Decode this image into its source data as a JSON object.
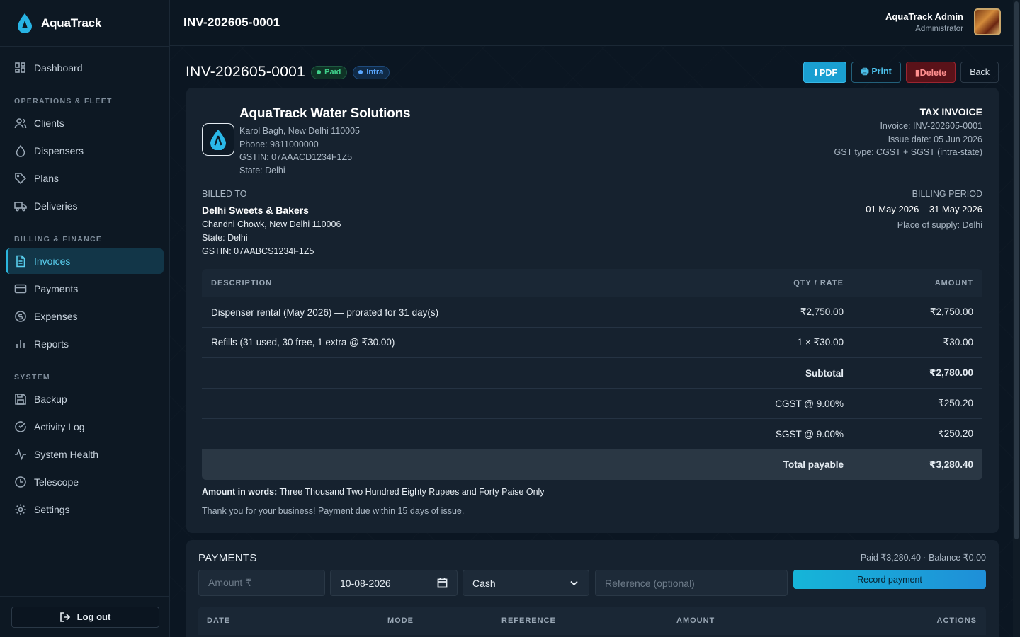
{
  "app": {
    "name": "AquaTrack"
  },
  "header": {
    "title": "INV-202605-0001",
    "user_name": "AquaTrack Admin",
    "user_role": "Administrator"
  },
  "sidebar": {
    "dashboard": "Dashboard",
    "sections": {
      "ops": "OPERATIONS & FLEET",
      "billing": "BILLING & FINANCE",
      "system": "SYSTEM"
    },
    "items": {
      "clients": "Clients",
      "dispensers": "Dispensers",
      "plans": "Plans",
      "deliveries": "Deliveries",
      "invoices": "Invoices",
      "payments": "Payments",
      "expenses": "Expenses",
      "reports": "Reports",
      "backup": "Backup",
      "activity": "Activity Log",
      "health": "System Health",
      "telescope": "Telescope",
      "settings": "Settings"
    },
    "logout": "Log out",
    "active": "invoices"
  },
  "page": {
    "title": "INV-202605-0001",
    "badges": {
      "paid": "Paid",
      "intra": "Intra"
    },
    "actions": {
      "pdf": "⬇PDF",
      "print": "🖶 Print",
      "delete": "▮Delete",
      "back": "Back"
    }
  },
  "invoice": {
    "company": {
      "name": "AquaTrack Water Solutions",
      "address": "Karol Bagh, New Delhi 110005",
      "phone": "Phone: 9811000000",
      "gstin": "GSTIN: 07AAACD1234F1Z5",
      "state": "State: Delhi"
    },
    "meta": {
      "heading": "TAX INVOICE",
      "invoice": "Invoice: INV-202605-0001",
      "issue": "Issue date: 05 Jun 2026",
      "gst_type": "GST type: CGST + SGST (intra-state)"
    },
    "billed_to": {
      "label": "BILLED TO",
      "name": "Delhi Sweets & Bakers",
      "address": "Chandni Chowk, New Delhi 110006",
      "state": "State: Delhi",
      "gstin": "GSTIN: 07AABCS1234F1Z5"
    },
    "period": {
      "label": "BILLING PERIOD",
      "value": "01 May 2026 – 31 May 2026",
      "supply": "Place of supply: Delhi"
    },
    "table": {
      "headers": {
        "desc": "DESCRIPTION",
        "qty": "QTY / RATE",
        "amount": "AMOUNT"
      },
      "rows": [
        {
          "desc": "Dispenser rental (May 2026) — prorated for 31 day(s)",
          "qty": "₹2,750.00",
          "amount": "₹2,750.00"
        },
        {
          "desc": "Refills (31 used, 30 free, 1 extra @ ₹30.00)",
          "qty": "1 × ₹30.00",
          "amount": "₹30.00"
        }
      ],
      "subtotal_label": "Subtotal",
      "subtotal": "₹2,780.00",
      "cgst_label": "CGST @ 9.00%",
      "cgst": "₹250.20",
      "sgst_label": "SGST @ 9.00%",
      "sgst": "₹250.20",
      "total_label": "Total payable",
      "total": "₹3,280.40"
    },
    "words_label": "Amount in words:",
    "words": "Three Thousand Two Hundred Eighty Rupees and Forty Paise Only",
    "thanks": "Thank you for your business! Payment due within 15 days of issue."
  },
  "payments": {
    "title": "PAYMENTS",
    "summary": "Paid ₹3,280.40 · Balance ₹0.00",
    "amount_placeholder": "Amount ₹",
    "date": "10-08-2026",
    "mode": "Cash",
    "reference_placeholder": "Reference (optional)",
    "record": "Record payment",
    "columns": {
      "date": "DATE",
      "mode": "MODE",
      "reference": "REFERENCE",
      "amount": "AMOUNT",
      "actions": "ACTIONS"
    }
  },
  "colors": {
    "accent": "#1a9fd1",
    "paid": "#3fd08a",
    "intra": "#5aa7ff",
    "danger": "#9b2530"
  }
}
